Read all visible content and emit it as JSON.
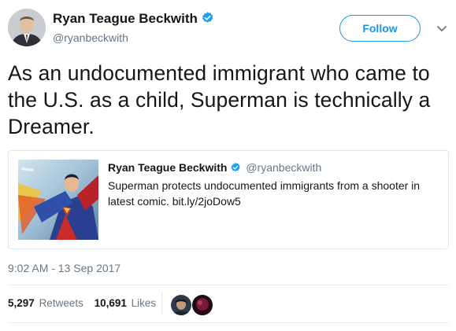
{
  "author": {
    "name": "Ryan Teague Beckwith",
    "handle": "@ryanbeckwith",
    "verified_icon": "verified-badge-icon"
  },
  "follow_label": "Follow",
  "menu_icon": "chevron-down-icon",
  "tweet": {
    "text": "As an undocumented immigrant who came to the U.S. as a child, Superman is technically a Dreamer."
  },
  "quoted_tweet": {
    "name": "Ryan Teague Beckwith",
    "handle": "@ryanbeckwith",
    "text": "Superman protects undocumented immigrants from a shooter in latest comic. bit.ly/2joDow5"
  },
  "timestamp": "9:02 AM - 13 Sep 2017",
  "stats": {
    "retweets_count": "5,297",
    "retweets_label": "Retweets",
    "likes_count": "10,691",
    "likes_label": "Likes"
  },
  "colors": {
    "accent": "#1b95e0",
    "secondary_text": "#657786",
    "border": "#e1e8ed"
  }
}
